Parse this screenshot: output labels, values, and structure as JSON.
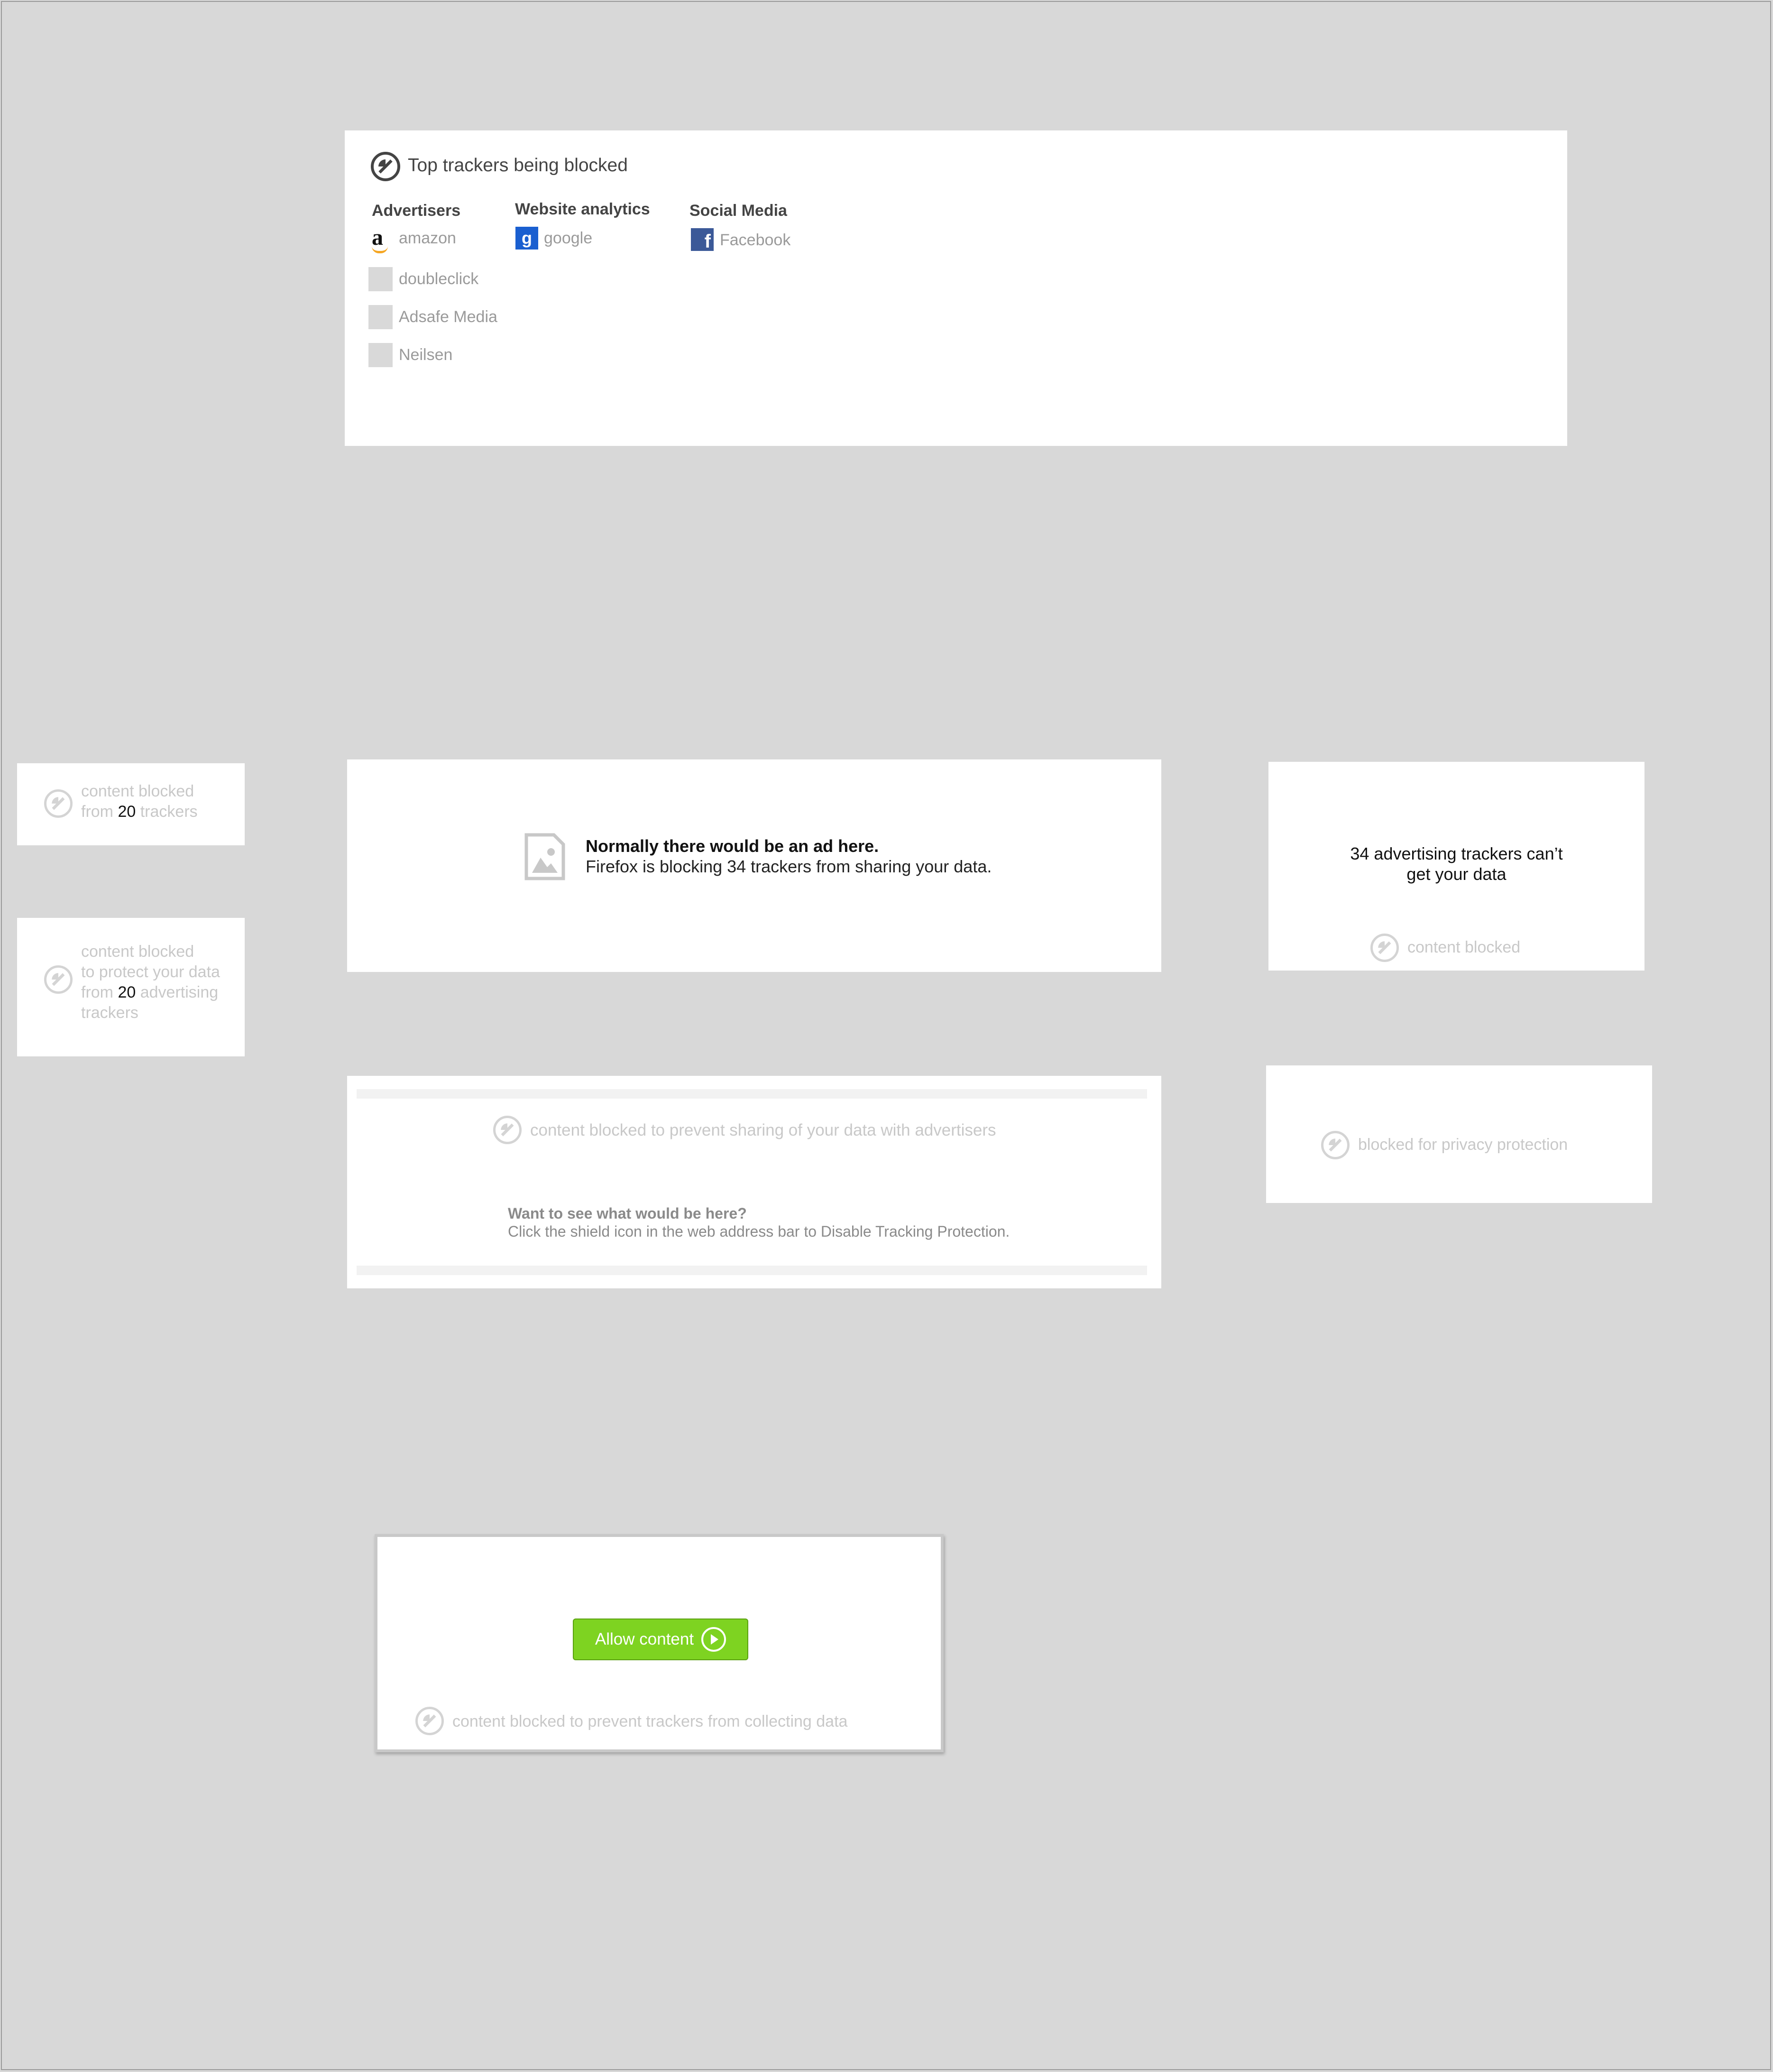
{
  "top_panel": {
    "title": "Top trackers being blocked",
    "columns": [
      {
        "heading": "Advertisers",
        "items": [
          "amazon",
          "doubleclick",
          "Adsafe Media",
          "Neilsen"
        ]
      },
      {
        "heading": "Website analytics",
        "items": [
          "google"
        ]
      },
      {
        "heading": "Social Media",
        "items": [
          "Facebook"
        ]
      }
    ]
  },
  "small_card_1": {
    "line1": "content blocked",
    "line2_pre": "from ",
    "count": "20",
    "line2_post": " trackers"
  },
  "small_card_2": {
    "line1": "content blocked",
    "line2": "to protect your data",
    "line3_pre": "from ",
    "count": "20",
    "line3_post": " advertising",
    "line4": "trackers"
  },
  "ad_card": {
    "heading": "Normally there would be an ad here.",
    "body": "Firefox is blocking 34 trackers from sharing your data."
  },
  "right_card_1": {
    "line1": "34 advertising trackers can’t",
    "line2": "get your data",
    "footer": "content blocked"
  },
  "share_card": {
    "blocked_text": "content blocked to prevent sharing of your data with advertisers",
    "question": "Want to see what would be here?",
    "instructions": "Click the shield icon in the web address bar to Disable Tracking Protection."
  },
  "right_card_2": {
    "text": "blocked for privacy protection"
  },
  "allow_card": {
    "button_label": "Allow content",
    "footer": "content blocked to prevent trackers from collecting data",
    "button_color": "#7ed321"
  }
}
